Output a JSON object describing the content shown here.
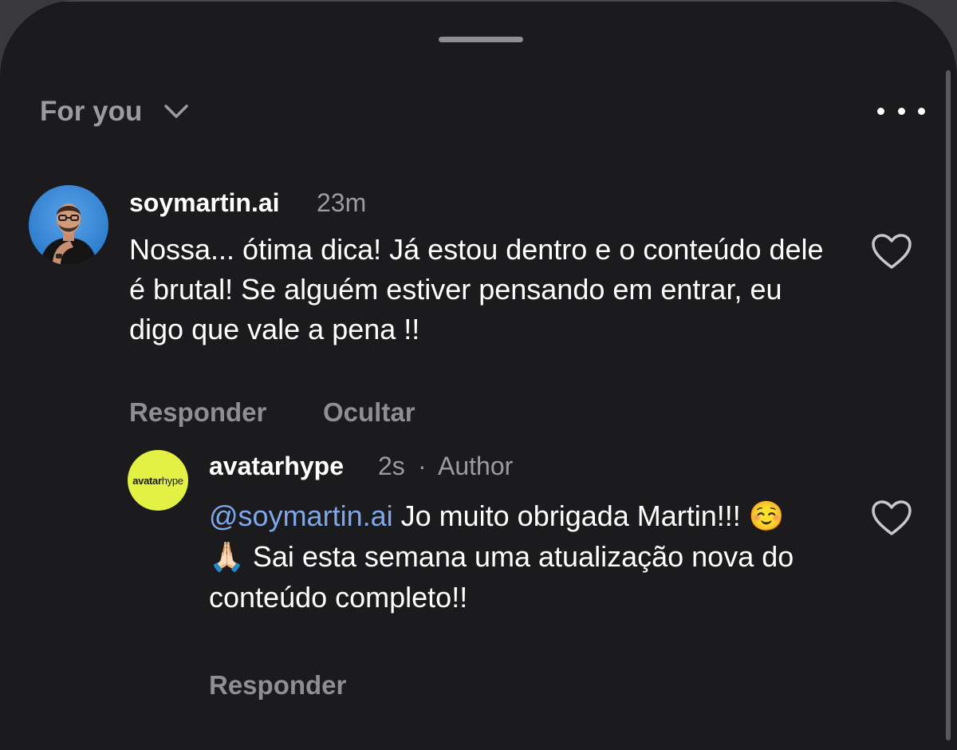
{
  "header": {
    "title": "For you",
    "chevron_icon": "chevron-down-icon",
    "more_icon": "more-horizontal-icon"
  },
  "comments": [
    {
      "username": "soymartin.ai",
      "time": "23m",
      "text": "Nossa... ótima dica! Já estou dentro e o conteúdo dele é brutal! Se alguém estiver pensando em entrar, eu digo que vale a pena !!",
      "actions": [
        "Responder",
        "Ocultar"
      ],
      "like_icon": "heart-outline-icon"
    }
  ],
  "reply": {
    "username": "avatarhype",
    "time": "2s",
    "separator": "·",
    "badge": "Author",
    "avatar_text_bold": "avatar",
    "avatar_text_light": "hype",
    "mention": "@soymartin.ai",
    "text_part1": " Jo muito obrigada Martin!!! ",
    "emoji1": "☺️",
    "emoji2": "🙏🏻",
    "text_part2": "  Sai esta semana uma atualização nova do conteúdo completo!!",
    "action": "Responder",
    "like_icon": "heart-outline-icon"
  },
  "colors": {
    "background": "#1b1b1d",
    "primary_text": "#ffffff",
    "secondary_text": "#9b9ba0",
    "mention": "#7ea8ee",
    "author_avatar": "#e3f044"
  }
}
